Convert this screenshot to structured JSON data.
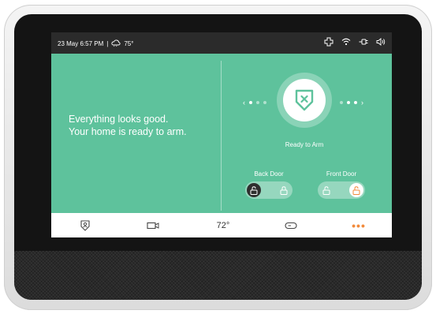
{
  "status": {
    "date_time": "23 May 6:57 PM",
    "separator": "|",
    "weather_temp": "75°",
    "icons": [
      "weather-cloud-icon",
      "cross-icon",
      "wifi-icon",
      "plug-icon",
      "volume-icon"
    ]
  },
  "main": {
    "message_line1": "Everything looks good.",
    "message_line2": "Your home is ready to arm.",
    "arm_status": "Ready to Arm",
    "carousel": {
      "pages": 3,
      "active_left": 1,
      "prev_label": "‹",
      "next_label": "›"
    }
  },
  "doors": [
    {
      "label": "Back Door",
      "state": "unlocked"
    },
    {
      "label": "Front Door",
      "state": "unlocked"
    }
  ],
  "nav": {
    "temperature": "72°",
    "more_label": "•••",
    "icons": [
      "security-shield-icon",
      "camera-icon",
      "thermostat-temperature",
      "device-pill-icon",
      "more-icon"
    ]
  },
  "colors": {
    "screen_bg": "#5ec29c",
    "accent_orange": "#f28b3c",
    "status_bar": "#2b2b2b"
  }
}
